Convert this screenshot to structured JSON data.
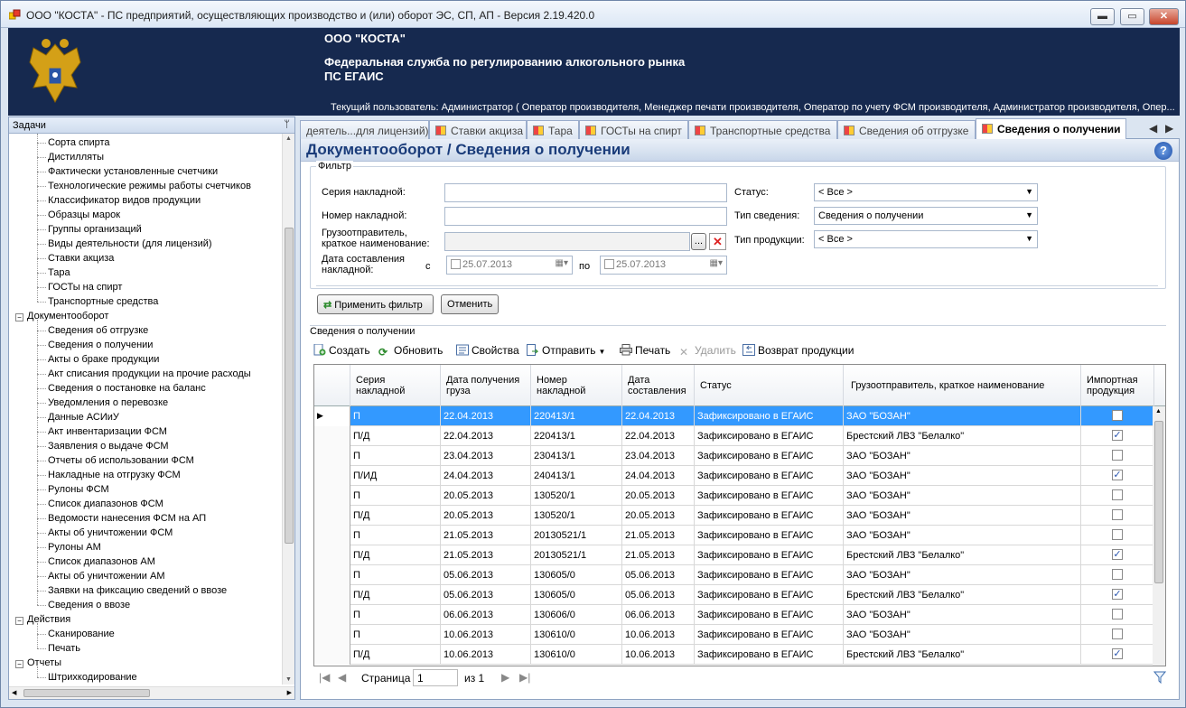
{
  "window": {
    "title": "ООО \"КОСТА\" - ПС предприятий, осуществляющих производство и (или) оборот ЭС, СП, АП - Версия 2.19.420.0",
    "min_label": "▬",
    "max_label": "▭",
    "close_label": "✕"
  },
  "banner": {
    "org": "ООО \"КОСТА\"",
    "agency": "Федеральная служба по регулированию алкогольного рынка",
    "system": "ПС ЕГАИС",
    "user": "Текущий пользователь: Администратор ( Оператор производителя, Менеджер печати производителя, Оператор по учету ФСМ производителя, Администратор производителя, Опер..."
  },
  "tasks": {
    "header": "Задачи",
    "pin": "ᛘ",
    "items_top": [
      "Сорта спирта",
      "Дистилляты",
      "Фактически установленные счетчики",
      "Технологические режимы работы счетчиков",
      "Классификатор видов продукции",
      "Образцы марок",
      "Группы организаций",
      "Виды деятельности (для лицензий)",
      "Ставки акциза",
      "Тара",
      "ГОСТы на спирт",
      "Транспортные средства"
    ],
    "group_docs": "Документооборот",
    "items_docs": [
      "Сведения об отгрузке",
      "Сведения о получении",
      "Акты о браке продукции",
      "Акт списания продукции на прочие расходы",
      "Сведения о постановке на баланс",
      "Уведомления о перевозке",
      "Данные АСИиУ",
      "Акт инвентаризации ФСМ",
      "Заявления о выдаче ФСМ",
      "Отчеты об использовании ФСМ",
      "Накладные на отгрузку ФСМ",
      "Рулоны ФСМ",
      "Список диапазонов ФСМ",
      "Ведомости нанесения ФСМ на АП",
      "Акты об уничтожении ФСМ",
      "Рулоны АМ",
      "Список диапазонов АМ",
      "Акты об уничтожении АМ",
      "Заявки на фиксацию сведений о ввозе",
      "Сведения о ввозе"
    ],
    "group_actions": "Действия",
    "items_actions": [
      "Сканирование",
      "Печать"
    ],
    "group_reports": "Отчеты",
    "items_reports": [
      "Штрихкодирование"
    ]
  },
  "tabs": [
    "деятель...для лицензий)",
    "Ставки акциза",
    "Тара",
    "ГОСТы на спирт",
    "Транспортные средства",
    "Сведения об отгрузке",
    "Сведения о получении"
  ],
  "tab_nav": {
    "prev": "◀",
    "next": "▶"
  },
  "page": {
    "title": "Документооборот  / Сведения о получении",
    "help": "?"
  },
  "filter": {
    "legend": "Фильтр",
    "series_label": "Серия накладной:",
    "number_label": "Номер накладной:",
    "shipper_label": "Грузоотправитель,\nкраткое наименование:",
    "date_label": "Дата составления\nнакладной:",
    "from_label": "с",
    "to_label": "по",
    "date_from": "25.07.2013",
    "date_to": "25.07.2013",
    "browse": "...",
    "clear": "✕",
    "status_label": "Статус:",
    "status_value": "< Все >",
    "info_type_label": "Тип сведения:",
    "info_type_value": "Сведения о получении",
    "product_type_label": "Тип продукции:",
    "product_type_value": "< Все >",
    "apply_button": "Применить фильтр",
    "cancel_button": "Отменить"
  },
  "section": {
    "title": "Сведения о получении"
  },
  "toolbar": {
    "create": "Создать",
    "refresh": "Обновить",
    "props": "Свойства",
    "send": "Отправить",
    "print": "Печать",
    "delete": "Удалить",
    "return": "Возврат продукции"
  },
  "grid": {
    "columns": [
      "Серия накладной",
      "Дата получения груза",
      "Номер накладной",
      "Дата составления",
      "Статус",
      "Грузоотправитель, краткое наименование",
      "Импортная продукция"
    ],
    "rows": [
      {
        "series": "П",
        "recv": "22.04.2013",
        "num": "220413/1",
        "made": "22.04.2013",
        "status": "Зафиксировано в ЕГАИС",
        "shipper": "ЗАО \"БОЗАН\"",
        "import": false
      },
      {
        "series": "П/Д",
        "recv": "22.04.2013",
        "num": "220413/1",
        "made": "22.04.2013",
        "status": "Зафиксировано в ЕГАИС",
        "shipper": "Брестский ЛВЗ \"Белалко\"",
        "import": true
      },
      {
        "series": "П",
        "recv": "23.04.2013",
        "num": "230413/1",
        "made": "23.04.2013",
        "status": "Зафиксировано в ЕГАИС",
        "shipper": "ЗАО \"БОЗАН\"",
        "import": false
      },
      {
        "series": "П/ИД",
        "recv": "24.04.2013",
        "num": "240413/1",
        "made": "24.04.2013",
        "status": "Зафиксировано в ЕГАИС",
        "shipper": "ЗАО \"БОЗАН\"",
        "import": true
      },
      {
        "series": "П",
        "recv": "20.05.2013",
        "num": "130520/1",
        "made": "20.05.2013",
        "status": "Зафиксировано в ЕГАИС",
        "shipper": "ЗАО \"БОЗАН\"",
        "import": false
      },
      {
        "series": "П/Д",
        "recv": "20.05.2013",
        "num": "130520/1",
        "made": "20.05.2013",
        "status": "Зафиксировано в ЕГАИС",
        "shipper": "ЗАО \"БОЗАН\"",
        "import": false
      },
      {
        "series": "П",
        "recv": "21.05.2013",
        "num": "20130521/1",
        "made": "21.05.2013",
        "status": "Зафиксировано в ЕГАИС",
        "shipper": "ЗАО \"БОЗАН\"",
        "import": false
      },
      {
        "series": "П/Д",
        "recv": "21.05.2013",
        "num": "20130521/1",
        "made": "21.05.2013",
        "status": "Зафиксировано в ЕГАИС",
        "shipper": "Брестский ЛВЗ \"Белалко\"",
        "import": true
      },
      {
        "series": "П",
        "recv": "05.06.2013",
        "num": "130605/0",
        "made": "05.06.2013",
        "status": "Зафиксировано в ЕГАИС",
        "shipper": "ЗАО \"БОЗАН\"",
        "import": false
      },
      {
        "series": "П/Д",
        "recv": "05.06.2013",
        "num": "130605/0",
        "made": "05.06.2013",
        "status": "Зафиксировано в ЕГАИС",
        "shipper": "Брестский ЛВЗ \"Белалко\"",
        "import": true
      },
      {
        "series": "П",
        "recv": "06.06.2013",
        "num": "130606/0",
        "made": "06.06.2013",
        "status": "Зафиксировано в ЕГАИС",
        "shipper": "ЗАО \"БОЗАН\"",
        "import": false
      },
      {
        "series": "П",
        "recv": "10.06.2013",
        "num": "130610/0",
        "made": "10.06.2013",
        "status": "Зафиксировано в ЕГАИС",
        "shipper": "ЗАО \"БОЗАН\"",
        "import": false
      },
      {
        "series": "П/Д",
        "recv": "10.06.2013",
        "num": "130610/0",
        "made": "10.06.2013",
        "status": "Зафиксировано в ЕГАИС",
        "shipper": "Брестский ЛВЗ \"Белалко\"",
        "import": true
      }
    ],
    "selected_row": 0,
    "row_marker": "▶",
    "check_mark": "✓"
  },
  "pager": {
    "page_label": "Страница",
    "page_value": "1",
    "of_label": "из 1",
    "first": "|◀",
    "prev": "◀",
    "next": "▶",
    "last": "▶|",
    "filter_icon": "filter-icon"
  },
  "colors": {
    "banner": "#16294f",
    "selected_row": "#3399ff",
    "title_text": "#1a3c7a"
  }
}
